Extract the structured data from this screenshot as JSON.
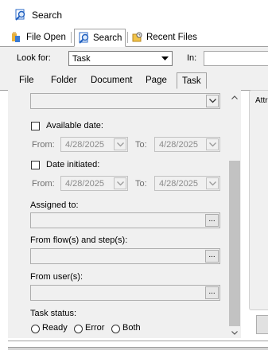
{
  "window": {
    "title": "Search"
  },
  "tool_tabs": [
    {
      "label": "File Open",
      "icon": "file-open-icon"
    },
    {
      "label": "Search",
      "icon": "search-icon"
    },
    {
      "label": "Recent Files",
      "icon": "recent-files-icon"
    }
  ],
  "look_for": {
    "label": "Look for:",
    "value": "Task",
    "in_label": "In:",
    "in_value": ""
  },
  "sub_tabs": [
    "File",
    "Folder",
    "Document",
    "Page",
    "Task"
  ],
  "task": {
    "available_date": {
      "label": "Available date:",
      "from_label": "From:",
      "from_value": "4/28/2025",
      "to_label": "To:",
      "to_value": "4/28/2025"
    },
    "date_initiated": {
      "label": "Date initiated:",
      "from_label": "From:",
      "from_value": "4/28/2025",
      "to_label": "To:",
      "to_value": "4/28/2025"
    },
    "assigned_to": {
      "label": "Assigned to:",
      "value": ""
    },
    "from_flows": {
      "label": "From flow(s) and step(s):",
      "value": ""
    },
    "from_users": {
      "label": "From user(s):",
      "value": ""
    },
    "task_status": {
      "label": "Task status:",
      "options": [
        "Ready",
        "Error",
        "Both"
      ]
    },
    "ellipsis": "..."
  },
  "right": {
    "attr_label": "Attr"
  },
  "colors": {
    "panel": "#f0f0f0",
    "scroll_thumb": "#c2c2c2",
    "icon_blue": "#1f5fbf"
  }
}
